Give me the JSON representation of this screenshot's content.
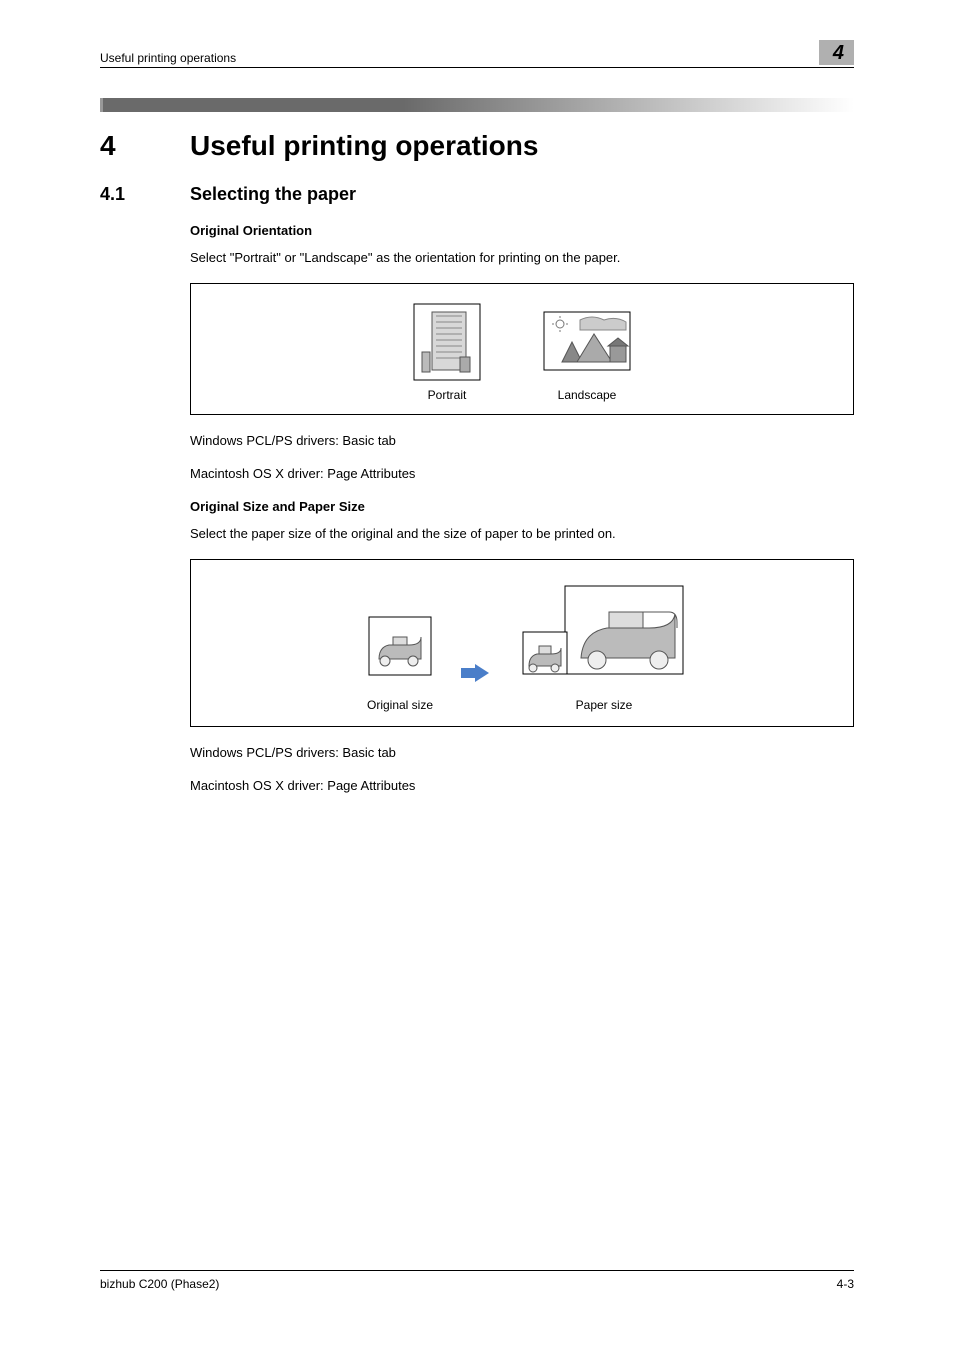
{
  "header": {
    "running_title": "Useful printing operations",
    "chapter_badge": "4"
  },
  "chapter": {
    "number": "4",
    "title": "Useful printing operations"
  },
  "section": {
    "number": "4.1",
    "title": "Selecting the paper"
  },
  "block1": {
    "subhead": "Original Orientation",
    "para": "Select \"Portrait\" or \"Landscape\" as the orientation for printing on the paper.",
    "fig_portrait": "Portrait",
    "fig_landscape": "Landscape",
    "note1": "Windows PCL/PS drivers: Basic tab",
    "note2": "Macintosh OS X driver: Page Attributes"
  },
  "block2": {
    "subhead": "Original Size and Paper Size",
    "para": "Select the paper size of the original and the size of paper to be printed on.",
    "fig_original": "Original size",
    "fig_paper": "Paper size",
    "note1": "Windows PCL/PS drivers: Basic tab",
    "note2": "Macintosh OS X driver: Page Attributes"
  },
  "footer": {
    "left": "bizhub C200 (Phase2)",
    "right": "4-3"
  }
}
